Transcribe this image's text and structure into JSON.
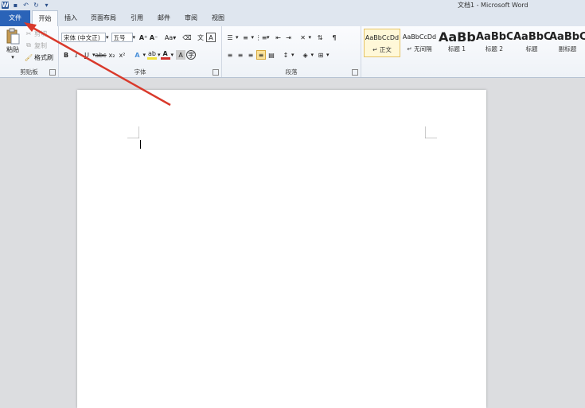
{
  "window": {
    "title": "文档1 - Microsoft Word"
  },
  "qat": {
    "app_icon": "W"
  },
  "tabs": [
    {
      "label": "文件"
    },
    {
      "label": "开始"
    },
    {
      "label": "插入"
    },
    {
      "label": "页面布局"
    },
    {
      "label": "引用"
    },
    {
      "label": "邮件"
    },
    {
      "label": "审阅"
    },
    {
      "label": "视图"
    }
  ],
  "clipboard": {
    "paste": "粘贴",
    "cut": "剪切",
    "copy": "复制",
    "format_painter": "格式刷",
    "label": "剪贴板"
  },
  "font": {
    "name": "宋体 (中文正)",
    "size": "五号",
    "label": "字体"
  },
  "paragraph": {
    "label": "段落"
  },
  "styles": [
    {
      "preview": "AaBbCcDd",
      "name": "↵ 正文"
    },
    {
      "preview": "AaBbCcDd",
      "name": "↵ 无间隔"
    },
    {
      "preview": "AaBb",
      "name": "标题 1"
    },
    {
      "preview": "AaBbC",
      "name": "标题 2"
    },
    {
      "preview": "AaBbC",
      "name": "标题"
    },
    {
      "preview": "AaBbC",
      "name": "副标题"
    }
  ],
  "colors": {
    "file_tab": "#2a63b8",
    "arrow": "#d9392b",
    "highlight": "#f2e23a",
    "font_color": "#d0312d"
  }
}
